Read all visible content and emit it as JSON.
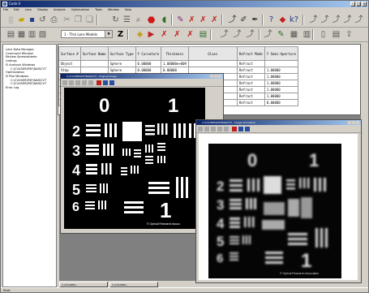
{
  "app": {
    "title": "Code V",
    "menu": [
      "File",
      "Edit",
      "Lens",
      "Display",
      "Analysis",
      "Optimization",
      "Tools",
      "Window",
      "Help"
    ]
  },
  "toolbar": {
    "lens_combo_value": "1 - Thin Lens Models",
    "combo_arrow": "▼",
    "icons": [
      "new-document-icon",
      "open-folder-icon",
      "save-icon",
      "undo-icon",
      "print-icon",
      "redo-icon",
      "stop-icon",
      "lens-icon",
      "help-icon",
      "ray-trace-icon",
      "tools-icon"
    ]
  },
  "sidebar": {
    "items": [
      {
        "label": "Lens Data Manager",
        "child": false
      },
      {
        "label": "Command Window",
        "child": false
      },
      {
        "label": "Review Spreadsheets",
        "child": false
      },
      {
        "label": "Listings",
        "child": false
      },
      {
        "label": "⊟ Analysis Windows",
        "child": false
      },
      {
        "label": "C:\\CVUSER\\PSF\\BAR\\CVT",
        "child": true
      },
      {
        "label": "Optimization",
        "child": false
      },
      {
        "label": "⊟ Plot Windows",
        "child": false
      },
      {
        "label": "C:\\CVUSER\\PSF\\BAR\\CVT",
        "child": true
      },
      {
        "label": "C:\\CVUSER\\PSF\\BAR\\CVT",
        "child": true
      },
      {
        "label": "Error Log",
        "child": false
      }
    ]
  },
  "spreadsheet": {
    "headers": [
      "Surface #",
      "Surface Name",
      "Surface Type",
      "Y Curvature",
      "Thickness",
      "Glass",
      "Refract Mode",
      "Y Semi-Aperture"
    ],
    "rows": [
      [
        "Object",
        "",
        "Sphere",
        "0.00000",
        "1.00000e+009",
        "",
        "Refract",
        ""
      ],
      [
        "Stop",
        "",
        "Sphere",
        "0.00000",
        "0.00000",
        "",
        "Refract",
        "1.00000"
      ],
      [
        "",
        "",
        "",
        "",
        "",
        "",
        "Refract",
        "1.00000"
      ],
      [
        "",
        "",
        "",
        "",
        "",
        "",
        "Refract",
        "1.00000"
      ],
      [
        "",
        "",
        "",
        "",
        "",
        "",
        "Refract",
        "1.00000"
      ],
      [
        "",
        "",
        "",
        "",
        "",
        "",
        "Refract",
        "1.00000"
      ],
      [
        "",
        "",
        "",
        "",
        "",
        "",
        "Refract",
        "0.00000"
      ]
    ]
  },
  "plot_window_1": {
    "title": "C:\\CVUSER\\PSF\\BAR\\CVT - Original Image",
    "copyright": "© Optical Research Assoc."
  },
  "plot_window_2": {
    "title": "C:\\CVUSER\\PSF\\BAR\\CVT - Image Simulation",
    "copyright": "© Optical Research Associates"
  },
  "target": {
    "big_numbers": [
      "0",
      "1"
    ],
    "side_numbers": [
      "2",
      "3",
      "4",
      "5",
      "6"
    ]
  },
  "taskbar": [
    "Start",
    "C:\\CVUSER\\...",
    "C:\\CVUSER\\..."
  ]
}
